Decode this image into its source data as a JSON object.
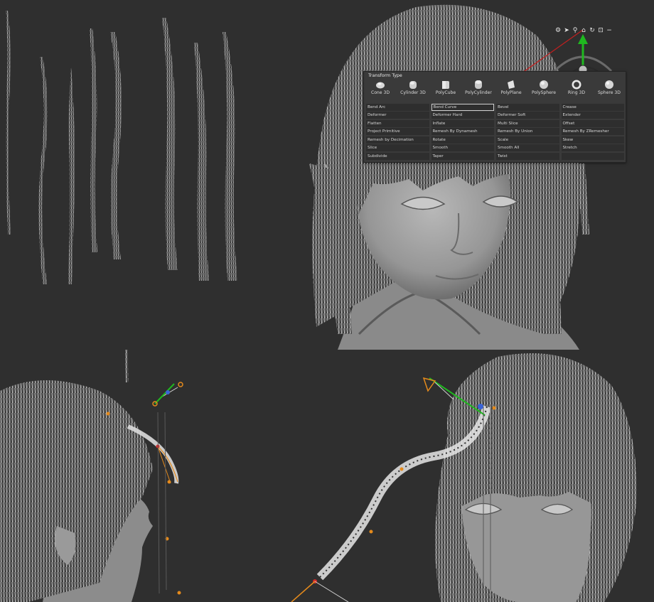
{
  "gizmo_toolbar": {
    "icons": [
      "gear-icon",
      "pointer-icon",
      "pin-icon",
      "home-icon",
      "undo-icon",
      "lock-icon",
      "minus-icon"
    ],
    "glyphs": [
      "⚙",
      "➤",
      "⚲",
      "⌂",
      "↻",
      "⊡",
      "−"
    ]
  },
  "transform_type": {
    "title": "Transform Type",
    "primitives": [
      "Cone 3D",
      "Cylinder 3D",
      "PolyCube",
      "PolyCylinder",
      "PolyPlane",
      "PolySphere",
      "Ring 3D",
      "Sphere 3D"
    ],
    "selected": "Bend Curve",
    "deformers": [
      "Bend Arc",
      "Bend Curve",
      "Bevel",
      "Crease",
      "Deformer",
      "Deformer Hard",
      "Deformer Soft",
      "Extender",
      "Flatten",
      "Inflate",
      "Multi Slice",
      "Offset",
      "Project Primitive",
      "Remesh By Dynamesh",
      "Remesh By Union",
      "Remesh By ZRemesher",
      "Remesh by Decimation",
      "Rotate",
      "Scale",
      "Skew",
      "Slice",
      "Smooth",
      "Smooth All",
      "Stretch",
      "Subdivide",
      "Taper",
      "Twist",
      ""
    ]
  },
  "colors": {
    "background": "#2f2f2f",
    "panel": "#3a3a3a",
    "gizmo_green": "#1fb81f",
    "gizmo_red": "#d62a2a",
    "handle_orange": "#e48a1c"
  }
}
